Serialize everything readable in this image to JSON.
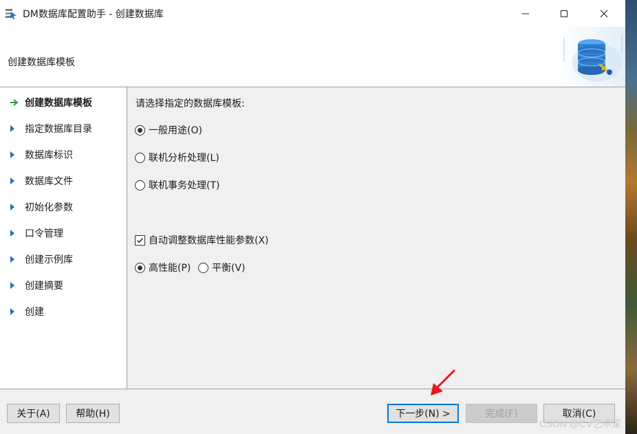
{
  "window": {
    "title": "DM数据库配置助手 - 创建数据库"
  },
  "header": {
    "title": "创建数据库模板"
  },
  "nav": {
    "items": [
      {
        "label": "创建数据库模板",
        "active": true
      },
      {
        "label": "指定数据库目录"
      },
      {
        "label": "数据库标识"
      },
      {
        "label": "数据库文件"
      },
      {
        "label": "初始化参数"
      },
      {
        "label": "口令管理"
      },
      {
        "label": "创建示例库"
      },
      {
        "label": "创建摘要"
      },
      {
        "label": "创建"
      }
    ]
  },
  "content": {
    "prompt": "请选择指定的数据库模板:",
    "templates": [
      {
        "label": "一般用途(O)",
        "selected": true
      },
      {
        "label": "联机分析处理(L)",
        "selected": false
      },
      {
        "label": "联机事务处理(T)",
        "selected": false
      }
    ],
    "auto_tune": {
      "label": "自动调整数据库性能参数(X)",
      "checked": true
    },
    "perf_modes": [
      {
        "label": "高性能(P)",
        "selected": true
      },
      {
        "label": "平衡(V)",
        "selected": false
      }
    ]
  },
  "buttons": {
    "about": "关于(A)",
    "help": "帮助(H)",
    "next": "下一步(N) >",
    "finish": "完成(F)",
    "cancel": "取消(C)"
  },
  "colors": {
    "accent": "#0078d7",
    "nav_arrow": "#1e73be",
    "active_arrow": "#2e9c3a",
    "annotation": "#e8171d"
  },
  "watermark": "CSDN @CV艺术家"
}
